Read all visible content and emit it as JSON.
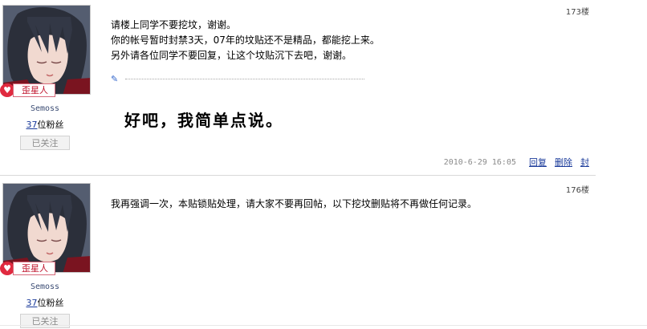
{
  "posts": [
    {
      "floor": "173楼",
      "user": {
        "rank": "歪星人",
        "name": "Semoss",
        "fans_count": "37",
        "fans_suffix": "位粉丝",
        "follow_state": "已关注"
      },
      "quote_lines": [
        "请楼上同学不要挖坟，谢谢。",
        "你的帐号暂时封禁3天，07年的坟贴还不是精品，都能挖上来。",
        "另外请各位同学不要回复，让这个坟贴沉下去吧，谢谢。"
      ],
      "reply": "好吧，我简单点说。",
      "timestamp": "2010-6-29 16:05",
      "actions": [
        "回复",
        "删除",
        "封"
      ]
    },
    {
      "floor": "176楼",
      "user": {
        "rank": "歪星人",
        "name": "Semoss",
        "fans_count": "37",
        "fans_suffix": "位粉丝",
        "follow_state": "已关注"
      },
      "body": "我再强调一次，本贴锁贴处理，请大家不要再回帖，以下挖坟删贴将不再做任何记录。"
    }
  ],
  "icons": {
    "rank_icon": "heart-icon",
    "quote_icon": "pencil-icon"
  },
  "colors": {
    "link": "#1a3a9a",
    "rank_red": "#c0152d",
    "timestamp_gray": "#8a8a8a"
  }
}
